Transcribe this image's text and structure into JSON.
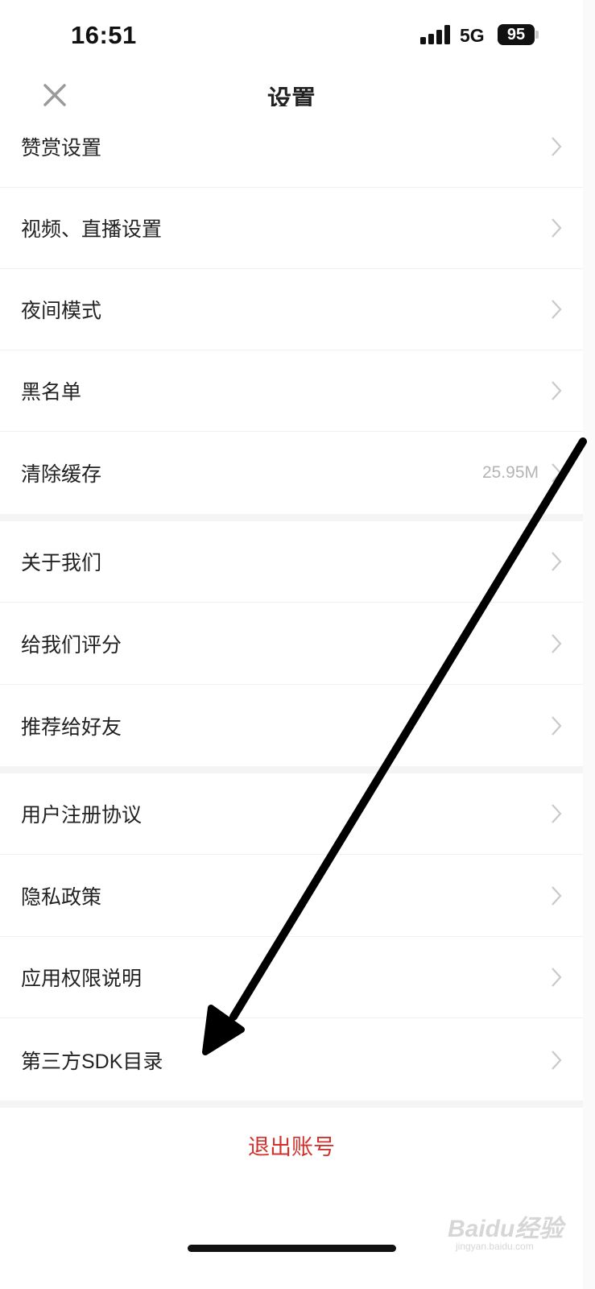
{
  "status_bar": {
    "time": "16:51",
    "network": "5G",
    "battery": "95"
  },
  "nav": {
    "title": "设置",
    "close_icon": "close-icon"
  },
  "groups": [
    {
      "items": [
        {
          "label": "赞赏设置"
        },
        {
          "label": "视频、直播设置"
        },
        {
          "label": "夜间模式"
        },
        {
          "label": "黑名单"
        },
        {
          "label": "清除缓存",
          "value": "25.95M"
        }
      ]
    },
    {
      "items": [
        {
          "label": "关于我们"
        },
        {
          "label": "给我们评分"
        },
        {
          "label": "推荐给好友"
        }
      ]
    },
    {
      "items": [
        {
          "label": "用户注册协议"
        },
        {
          "label": "隐私政策"
        },
        {
          "label": "应用权限说明"
        },
        {
          "label": "第三方SDK目录"
        }
      ]
    }
  ],
  "logout_label": "退出账号",
  "watermark": "Baidu经验",
  "watermark_sub": "jingyan.baidu.com",
  "colors": {
    "logout": "#d2322c",
    "secondary_text": "#b4b4b4",
    "separator": "#f4f4f4"
  },
  "icons": [
    "close-icon",
    "chevron-right-icon",
    "signal-icon",
    "battery-icon",
    "annotation-arrow"
  ]
}
